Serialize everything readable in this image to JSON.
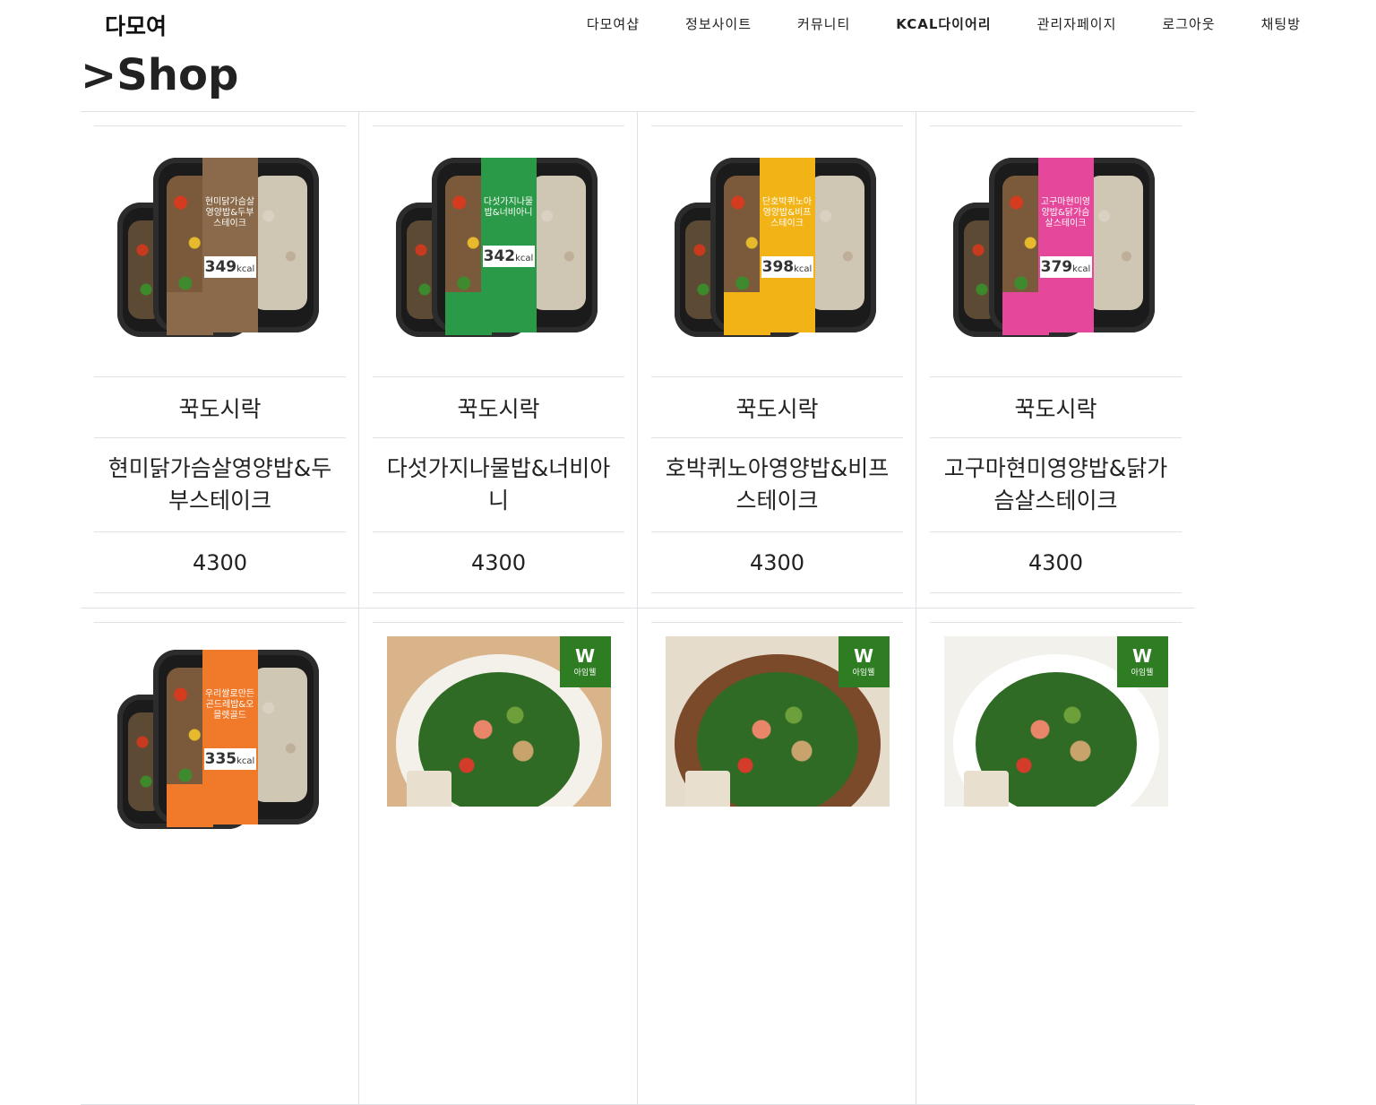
{
  "nav": {
    "brand": "다모여",
    "links": [
      "다모여샵",
      "정보사이트",
      "커뮤니티",
      "KCAL다이어리",
      "관리자페이지",
      "로그아웃",
      "채팅방"
    ]
  },
  "page_title": ">Shop",
  "products": [
    {
      "brand": "꾹도시락",
      "name": "현미닭가슴살영양밥&두부스테이크",
      "price": "4300",
      "image": {
        "kind": "lunchbox",
        "label_color": "#8a6a4a",
        "label_title": "현미닭가슴살영양밥&두부스테이크",
        "kcal": "349"
      }
    },
    {
      "brand": "꾹도시락",
      "name": "다섯가지나물밥&너비아니",
      "price": "4300",
      "image": {
        "kind": "lunchbox",
        "label_color": "#2b9a48",
        "label_title": "다섯가지나물밥&너비아니",
        "kcal": "342"
      }
    },
    {
      "brand": "꾹도시락",
      "name": "호박퀴노아영양밥&비프스테이크",
      "price": "4300",
      "image": {
        "kind": "lunchbox",
        "label_color": "#f2b316",
        "label_title": "단호박퀴노아영양밥&비프스테이크",
        "kcal": "398"
      }
    },
    {
      "brand": "꾹도시락",
      "name": "고구마현미영양밥&닭가슴살스테이크",
      "price": "4300",
      "image": {
        "kind": "lunchbox",
        "label_color": "#e5489a",
        "label_title": "고구마현미영양밥&닭가슴살스테이크",
        "kcal": "379"
      }
    },
    {
      "image": {
        "kind": "lunchbox",
        "label_color": "#f07a2a",
        "label_title": "우리쌀로만든곤드레밥&오믈렛골드",
        "kcal": "335"
      }
    },
    {
      "image": {
        "kind": "salad",
        "badge": "아임웰",
        "bg": "#d9b48a",
        "bowl": "#f4f1ea"
      }
    },
    {
      "image": {
        "kind": "salad",
        "badge": "아임웰",
        "bg": "#e6dccb",
        "bowl": "#7a4a2a"
      }
    },
    {
      "image": {
        "kind": "salad",
        "badge": "아임웰",
        "bg": "#f3f1ec",
        "bowl": "#ffffff"
      }
    }
  ]
}
